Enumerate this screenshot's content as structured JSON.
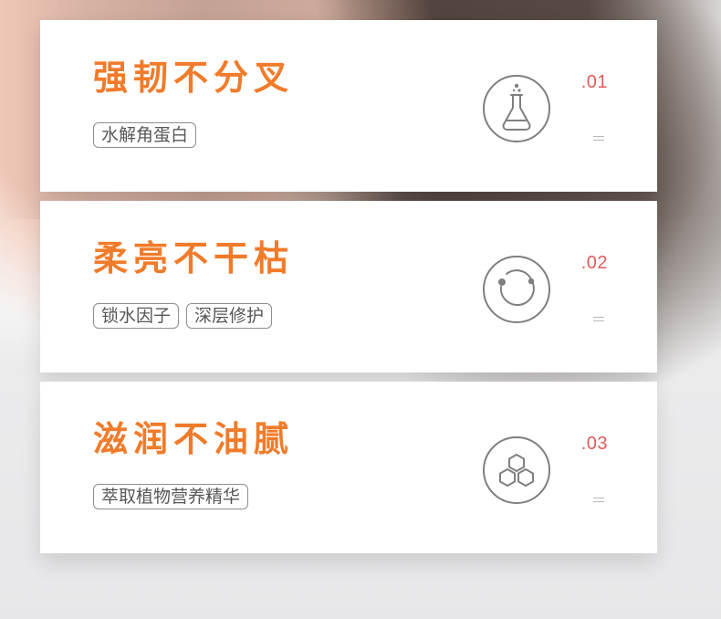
{
  "cards": [
    {
      "title": "强韧不分叉",
      "tags": [
        "水解角蛋白"
      ],
      "icon": "flask-icon",
      "number": ".01",
      "accent_color": "#f07b2a",
      "number_color": "#e35b5b"
    },
    {
      "title": "柔亮不干枯",
      "tags": [
        "锁水因子",
        "深层修护"
      ],
      "icon": "ring-molecule-icon",
      "number": ".02",
      "accent_color": "#f07b2a",
      "number_color": "#e35b5b"
    },
    {
      "title": "滋润不油腻",
      "tags": [
        "萃取植物营养精华"
      ],
      "icon": "hexagon-cluster-icon",
      "number": ".03",
      "accent_color": "#f07b2a",
      "number_color": "#e35b5b"
    }
  ]
}
